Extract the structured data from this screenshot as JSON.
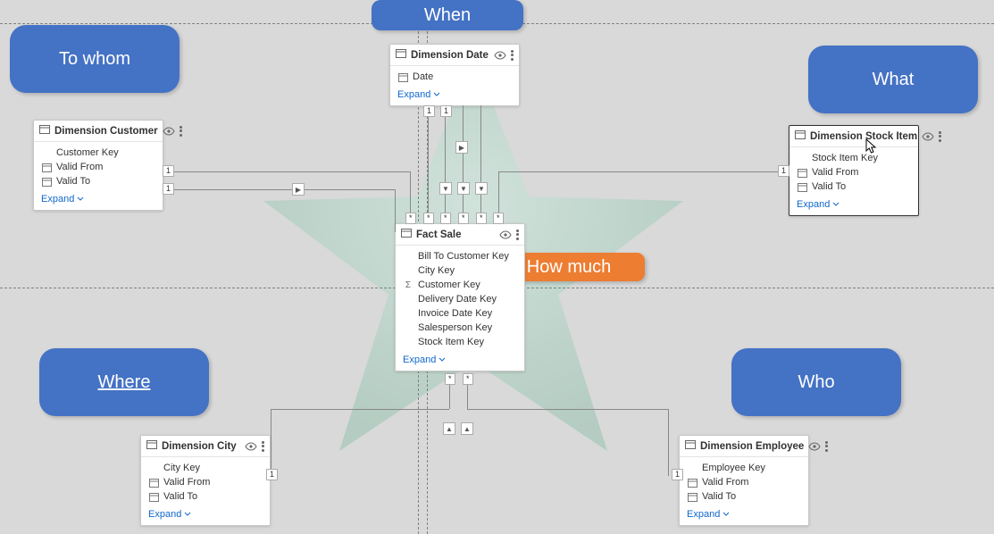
{
  "pills": {
    "when": {
      "label": "When"
    },
    "to_whom": {
      "label": "To whom"
    },
    "what": {
      "label": "What"
    },
    "where": {
      "label": "Where"
    },
    "who": {
      "label": "Who"
    },
    "how_much": {
      "label": "How much"
    }
  },
  "tables": {
    "dimension_date": {
      "title": "Dimension Date",
      "fields": [
        "Date"
      ],
      "expand": "Expand"
    },
    "dimension_customer": {
      "title": "Dimension Customer",
      "fields": [
        "Customer Key",
        "Valid From",
        "Valid To"
      ],
      "expand": "Expand"
    },
    "dimension_stock_item": {
      "title": "Dimension Stock Item",
      "fields": [
        "Stock Item Key",
        "Valid From",
        "Valid To"
      ],
      "expand": "Expand"
    },
    "fact_sale": {
      "title": "Fact Sale",
      "fields": [
        "Bill To Customer Key",
        "City Key",
        "Customer Key",
        "Delivery Date Key",
        "Invoice Date Key",
        "Salesperson Key",
        "Stock Item Key"
      ],
      "expand": "Expand"
    },
    "dimension_city": {
      "title": "Dimension City",
      "fields": [
        "City Key",
        "Valid From",
        "Valid To"
      ],
      "expand": "Expand"
    },
    "dimension_employee": {
      "title": "Dimension Employee",
      "fields": [
        "Employee Key",
        "Valid From",
        "Valid To"
      ],
      "expand": "Expand"
    }
  },
  "cardinality": {
    "one": "1",
    "many": "*"
  }
}
